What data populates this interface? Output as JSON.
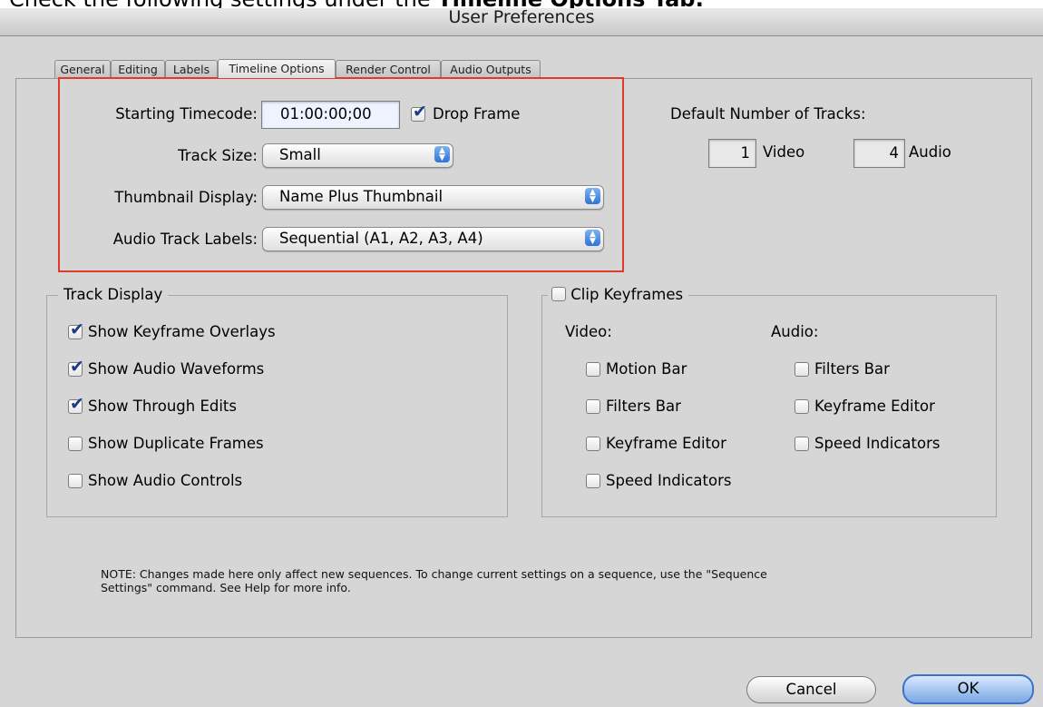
{
  "instruction": {
    "prefix": "Check the following settings under the ",
    "bold": "Timeline Options Tab:"
  },
  "window": {
    "title": "User Preferences"
  },
  "tabs": [
    {
      "label": "General"
    },
    {
      "label": "Editing"
    },
    {
      "label": "Labels"
    },
    {
      "label": "Timeline Options",
      "active": true
    },
    {
      "label": "Render Control"
    },
    {
      "label": "Audio Outputs"
    }
  ],
  "timeline": {
    "starting_timecode_label": "Starting Timecode:",
    "starting_timecode_value": "01:00:00;00",
    "drop_frame_label": "Drop Frame",
    "drop_frame_checked": true,
    "track_size_label": "Track Size:",
    "track_size_value": "Small",
    "thumbnail_display_label": "Thumbnail Display:",
    "thumbnail_display_value": "Name Plus Thumbnail",
    "audio_track_labels_label": "Audio Track Labels:",
    "audio_track_labels_value": "Sequential (A1, A2, A3, A4)"
  },
  "tracks": {
    "title": "Default Number of Tracks:",
    "video_count": "1",
    "video_label": "Video",
    "audio_count": "4",
    "audio_label": "Audio"
  },
  "track_display": {
    "title": "Track Display",
    "items": [
      {
        "label": "Show Keyframe Overlays",
        "checked": true
      },
      {
        "label": "Show Audio Waveforms",
        "checked": true
      },
      {
        "label": "Show Through Edits",
        "checked": true
      },
      {
        "label": "Show Duplicate Frames",
        "checked": false
      },
      {
        "label": "Show Audio Controls",
        "checked": false
      }
    ]
  },
  "clip_keyframes": {
    "title": "Clip Keyframes",
    "checked": false,
    "video_heading": "Video:",
    "audio_heading": "Audio:",
    "video_items": [
      {
        "label": "Motion Bar",
        "checked": false
      },
      {
        "label": "Filters Bar",
        "checked": false
      },
      {
        "label": "Keyframe Editor",
        "checked": false
      },
      {
        "label": "Speed Indicators",
        "checked": false
      }
    ],
    "audio_items": [
      {
        "label": "Filters Bar",
        "checked": false
      },
      {
        "label": "Keyframe Editor",
        "checked": false
      },
      {
        "label": "Speed Indicators",
        "checked": false
      }
    ]
  },
  "note": {
    "line1": "NOTE: Changes made here only affect new sequences. To change current settings on a sequence, use the \"Sequence",
    "line2": "Settings\" command. See Help for more info."
  },
  "buttons": {
    "cancel": "Cancel",
    "ok": "OK"
  },
  "colors": {
    "highlight": "#e03a2a",
    "accent": "#2f73d6"
  },
  "icons": {
    "check": "checkmark-icon",
    "popup": "popup-arrows-icon"
  }
}
